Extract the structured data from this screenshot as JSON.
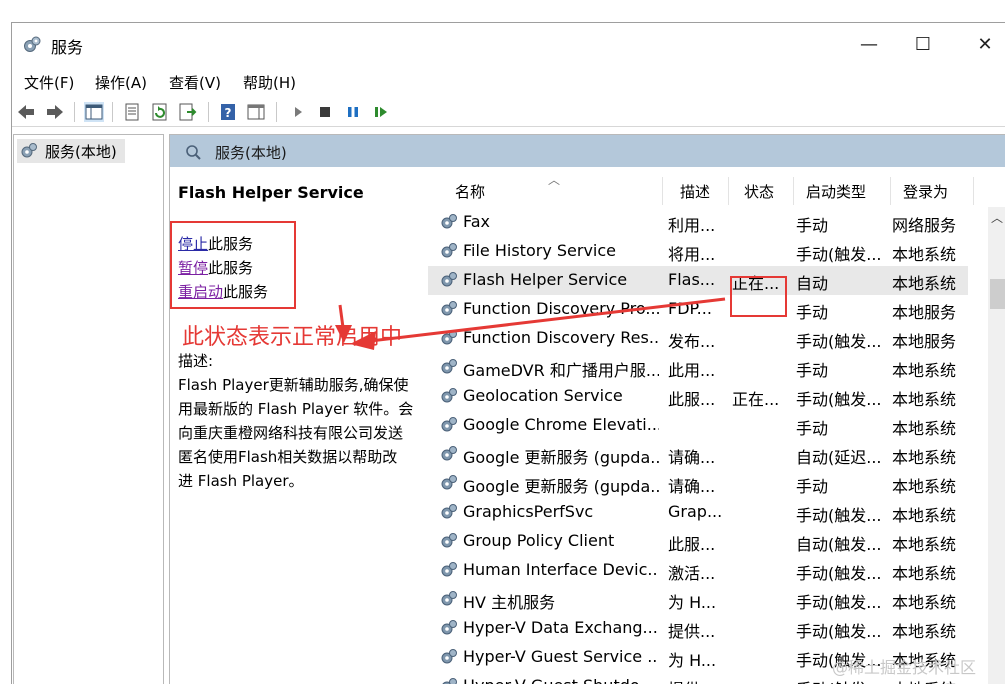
{
  "window": {
    "title": "服务",
    "controls": {
      "minimize": "—",
      "maximize": "☐",
      "close": "✕"
    }
  },
  "menu": [
    "文件(F)",
    "操作(A)",
    "查看(V)",
    "帮助(H)"
  ],
  "tree": {
    "label": "服务(本地)"
  },
  "pane_header": "服务(本地)",
  "details": {
    "service_name": "Flash Helper Service",
    "actions": [
      {
        "link": "停止",
        "suffix": "此服务"
      },
      {
        "link": "暂停",
        "suffix": "此服务"
      },
      {
        "link": "重启动",
        "suffix": "此服务"
      }
    ],
    "annotation": "此状态表示正常启用中",
    "desc_label": "描述:",
    "desc_lines": [
      "Flash Player更新辅助服务,确保使",
      "用最新版的 Flash Player 软件。会",
      "向重庆重橙网络科技有限公司发送",
      "匿名使用Flash相关数据以帮助改",
      "进 Flash Player。"
    ]
  },
  "table": {
    "columns": [
      "名称",
      "描述",
      "状态",
      "启动类型",
      "登录为"
    ],
    "rows": [
      {
        "name": "Fax",
        "desc": "利用...",
        "status": "",
        "startup": "手动",
        "logon": "网络服务"
      },
      {
        "name": "File History Service",
        "desc": "将用...",
        "status": "",
        "startup": "手动(触发...",
        "logon": "本地系统"
      },
      {
        "name": "Flash Helper Service",
        "desc": "Flas...",
        "status": "正在...",
        "startup": "自动",
        "logon": "本地系统",
        "selected": true
      },
      {
        "name": "Function Discovery Pro...",
        "desc": "FDP...",
        "status": "",
        "startup": "手动",
        "logon": "本地服务"
      },
      {
        "name": "Function Discovery Res...",
        "desc": "发布...",
        "status": "",
        "startup": "手动(触发...",
        "logon": "本地服务"
      },
      {
        "name": "GameDVR 和广播用户服...",
        "desc": "此用...",
        "status": "",
        "startup": "手动",
        "logon": "本地系统"
      },
      {
        "name": "Geolocation Service",
        "desc": "此服...",
        "status": "正在...",
        "startup": "手动(触发...",
        "logon": "本地系统"
      },
      {
        "name": "Google Chrome Elevati...",
        "desc": "",
        "status": "",
        "startup": "手动",
        "logon": "本地系统"
      },
      {
        "name": "Google 更新服务 (gupda...",
        "desc": "请确...",
        "status": "",
        "startup": "自动(延迟...",
        "logon": "本地系统"
      },
      {
        "name": "Google 更新服务 (gupda...",
        "desc": "请确...",
        "status": "",
        "startup": "手动",
        "logon": "本地系统"
      },
      {
        "name": "GraphicsPerfSvc",
        "desc": "Grap...",
        "status": "",
        "startup": "手动(触发...",
        "logon": "本地系统"
      },
      {
        "name": "Group Policy Client",
        "desc": "此服...",
        "status": "",
        "startup": "自动(触发...",
        "logon": "本地系统"
      },
      {
        "name": "Human Interface Devic...",
        "desc": "激活...",
        "status": "",
        "startup": "手动(触发...",
        "logon": "本地系统"
      },
      {
        "name": "HV 主机服务",
        "desc": "为 H...",
        "status": "",
        "startup": "手动(触发...",
        "logon": "本地系统"
      },
      {
        "name": "Hyper-V Data Exchang...",
        "desc": "提供...",
        "status": "",
        "startup": "手动(触发...",
        "logon": "本地系统"
      },
      {
        "name": "Hyper-V Guest Service ...",
        "desc": "为 H...",
        "status": "",
        "startup": "手动(触发...",
        "logon": "本地系统"
      },
      {
        "name": "Hyper-V Guest Shutdo...",
        "desc": "提供...",
        "status": "",
        "startup": "手动(触发...",
        "logon": "本地系统"
      }
    ]
  },
  "watermark": "@稀土掘金技术社区",
  "colors": {
    "header_bg": "#b4c8da",
    "annotation_red": "#e53935",
    "link_blue": "#2a2aa6"
  }
}
